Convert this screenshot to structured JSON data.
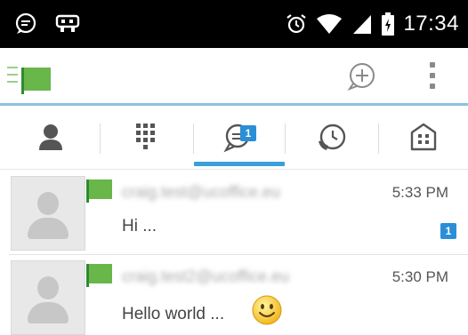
{
  "status_bar": {
    "time": "17:34",
    "icons": [
      "chat-bubble-icon",
      "usb-icon",
      "alarm-icon",
      "wifi-icon",
      "signal-icon",
      "battery-icon"
    ]
  },
  "action_bar": {
    "icons": [
      "menu-icon",
      "flag-icon",
      "add-chat-icon",
      "overflow-menu-icon"
    ],
    "colors": {
      "flag": "#69b64a",
      "divider": "#8cc1e4"
    }
  },
  "tabs": [
    {
      "icon": "person-icon",
      "selected": false
    },
    {
      "icon": "dialpad-icon",
      "selected": false
    },
    {
      "icon": "chat-icon",
      "selected": true,
      "badge": "1"
    },
    {
      "icon": "history-icon",
      "selected": false
    },
    {
      "icon": "building-icon",
      "selected": false
    }
  ],
  "conversations": [
    {
      "sender": "craig.test@ucoffice.eu",
      "time": "5:33 PM",
      "preview": "Hi ...",
      "unread": "1"
    },
    {
      "sender": "craig.test2@ucoffice.eu",
      "time": "5:30 PM",
      "preview": "Hello world ...",
      "emoji": "smiley-icon"
    }
  ],
  "colors": {
    "accent": "#3aa0da",
    "badge": "#2a8fd6"
  }
}
